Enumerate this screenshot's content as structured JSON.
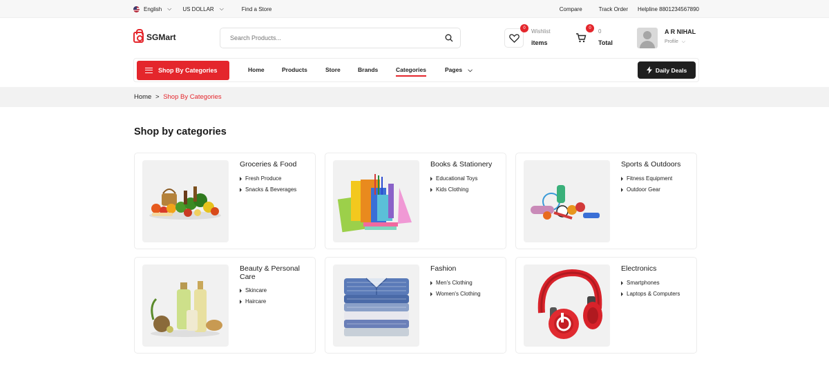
{
  "topbar": {
    "language": "English",
    "currency": "US DOLLAR",
    "find_store": "Find a Store",
    "compare": "Compare",
    "track_order": "Track Order",
    "helpline": "Helpline 8801234567890"
  },
  "header": {
    "logo": "SGMart",
    "search_placeholder": "Search Products...",
    "wishlist": {
      "count": "0",
      "label": "Wishlist",
      "value": "items"
    },
    "cart": {
      "count": "0",
      "label": "0",
      "value": "Total"
    },
    "user": {
      "name": "A R NIHAL",
      "sub": "Profile"
    }
  },
  "nav": {
    "categories_button": "Shop By Categories",
    "links": [
      "Home",
      "Products",
      "Store",
      "Brands",
      "Categories",
      "Pages"
    ],
    "active": "Categories",
    "deals": "Daily Deals"
  },
  "breadcrumb": {
    "home": "Home",
    "sep": ">",
    "current": "Shop By Categories"
  },
  "page_title": "Shop by categories",
  "categories": [
    {
      "title": "Groceries & Food",
      "items": [
        "Fresh Produce",
        "Snacks & Beverages"
      ],
      "image": "groceries-image"
    },
    {
      "title": "Books & Stationery",
      "items": [
        "Educational Toys",
        "Kids Clothing"
      ],
      "image": "stationery-image"
    },
    {
      "title": "Sports & Outdoors",
      "items": [
        "Fitness Equipment",
        "Outdoor Gear"
      ],
      "image": "sports-image"
    },
    {
      "title": "Beauty & Personal Care",
      "items": [
        "Skincare",
        "Haircare"
      ],
      "image": "beauty-image"
    },
    {
      "title": "Fashion",
      "items": [
        "Men's Clothing",
        "Women's Clothing"
      ],
      "image": "fashion-image"
    },
    {
      "title": "Electronics",
      "items": [
        "Smartphones",
        "Laptops & Computers"
      ],
      "image": "headphones-image"
    }
  ],
  "colors": {
    "accent": "#e4262c",
    "dark": "#1f1f1f",
    "band": "#f2f2f2"
  }
}
